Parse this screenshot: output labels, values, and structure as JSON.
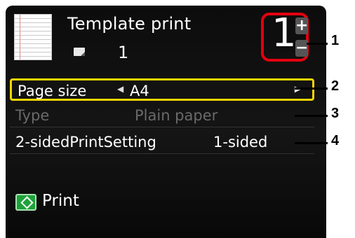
{
  "header": {
    "title": "Template print",
    "sheet_count": "1",
    "copies": "1",
    "plus_icon": "plus-icon",
    "minus_icon": "minus-icon",
    "copies_highlight_color": "#e3000f"
  },
  "settings": [
    {
      "label": "Page size",
      "value": "A4",
      "state": "selected",
      "selection_color": "#f2d600"
    },
    {
      "label": "Type",
      "value": "Plain paper",
      "state": "disabled"
    },
    {
      "label": "2-sidedPrintSetting",
      "value": "1-sided",
      "state": "normal"
    }
  ],
  "footer": {
    "button_icon": "start-icon",
    "button_label": "Print",
    "button_color": "#1fa13a"
  },
  "callouts": [
    "1",
    "2",
    "3",
    "4"
  ]
}
